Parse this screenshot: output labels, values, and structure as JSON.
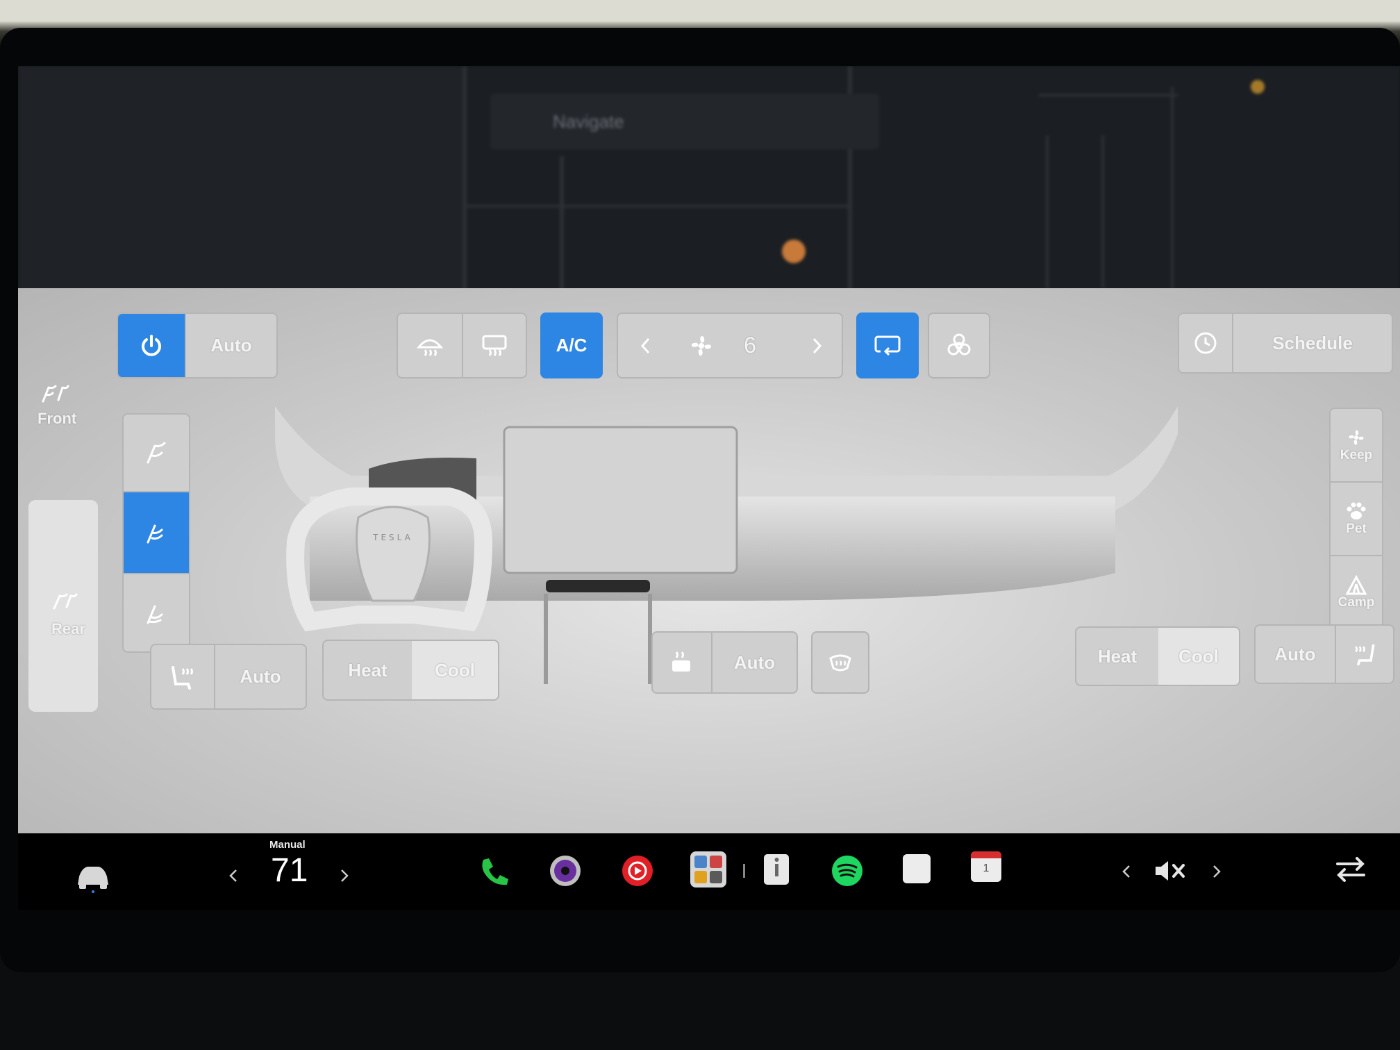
{
  "climate": {
    "power_label": "",
    "auto_label": "Auto",
    "ac_label": "A/C",
    "fan_speed": "6",
    "schedule_label": "Schedule",
    "front_label": "Front",
    "rear_label": "Rear",
    "modes": {
      "keep": "Keep",
      "pet": "Pet",
      "camp": "Camp"
    },
    "left_seat": {
      "auto_label": "Auto",
      "heat_label": "Heat",
      "cool_label": "Cool"
    },
    "center": {
      "auto_label": "Auto"
    },
    "right_seat": {
      "heat_label": "Heat",
      "cool_label": "Cool",
      "auto_label": "Auto"
    },
    "accent_color": "#2d86e3"
  },
  "map": {
    "search_placeholder": "Navigate",
    "steering_brand": "TESLA"
  },
  "dock": {
    "temp_mode": "Manual",
    "temperature": "71",
    "calendar_day": "1"
  }
}
